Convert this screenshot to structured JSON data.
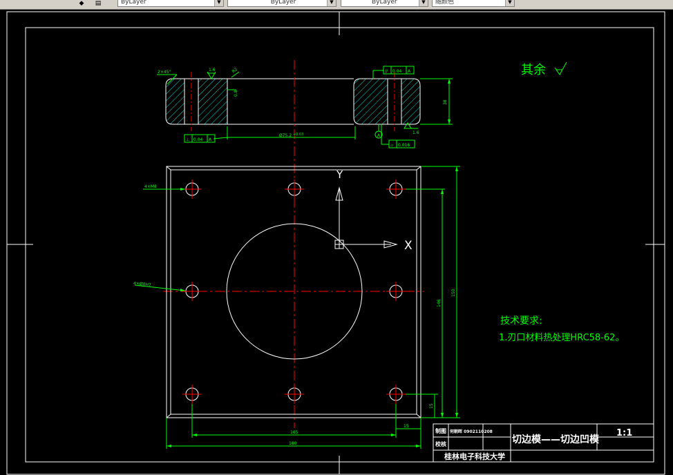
{
  "toolbar": {
    "layer_icons": [
      "layer-state-icon",
      "layer-previous-icon"
    ],
    "color_value": "ByLayer",
    "linetype_value": "ByLayer",
    "lineweight_value": "ByLayer",
    "plotstyle_value": "随颜色"
  },
  "drawing": {
    "roughness_note": "其余",
    "tech_req_title": "技术要求:",
    "tech_req_item": "1.刃口材料热处理HRC58-62。",
    "ucs": {
      "y_label": "Y",
      "x_label": "X"
    },
    "dims": {
      "chamfer": "2×45°",
      "rough_left": "1.6",
      "rough_right": "1.6",
      "small_a": "R2",
      "small_b": "0.8",
      "height": "38",
      "bore_dia": "Ø75.2",
      "bore_tol": "+0.03",
      "perp_tol": "0.04",
      "perp_datum": "A",
      "parallel_tol": "0.04",
      "parallel_datum": "A",
      "flat_tol": "0.016",
      "datum": "A",
      "holes_1": "4×M8",
      "holes_2": "4×Ø8H7",
      "dim_146": "146",
      "dim_150v": "150",
      "dim_165": "165",
      "dim_180": "180",
      "dim_15a": "15",
      "dim_15b": "15"
    }
  },
  "title_block": {
    "row1_left": "制图",
    "row1_name": "何朝晖 0902110208",
    "row2_left": "校核",
    "part_name": "切边模——切边凹模",
    "scale": "1:1",
    "school": "桂林电子科技大学"
  },
  "colors": {
    "line_white": "#ffffff",
    "line_green": "#00ff00",
    "line_red": "#ff0000",
    "hatch_cyan": "#00e0e0",
    "background": "#000000"
  }
}
